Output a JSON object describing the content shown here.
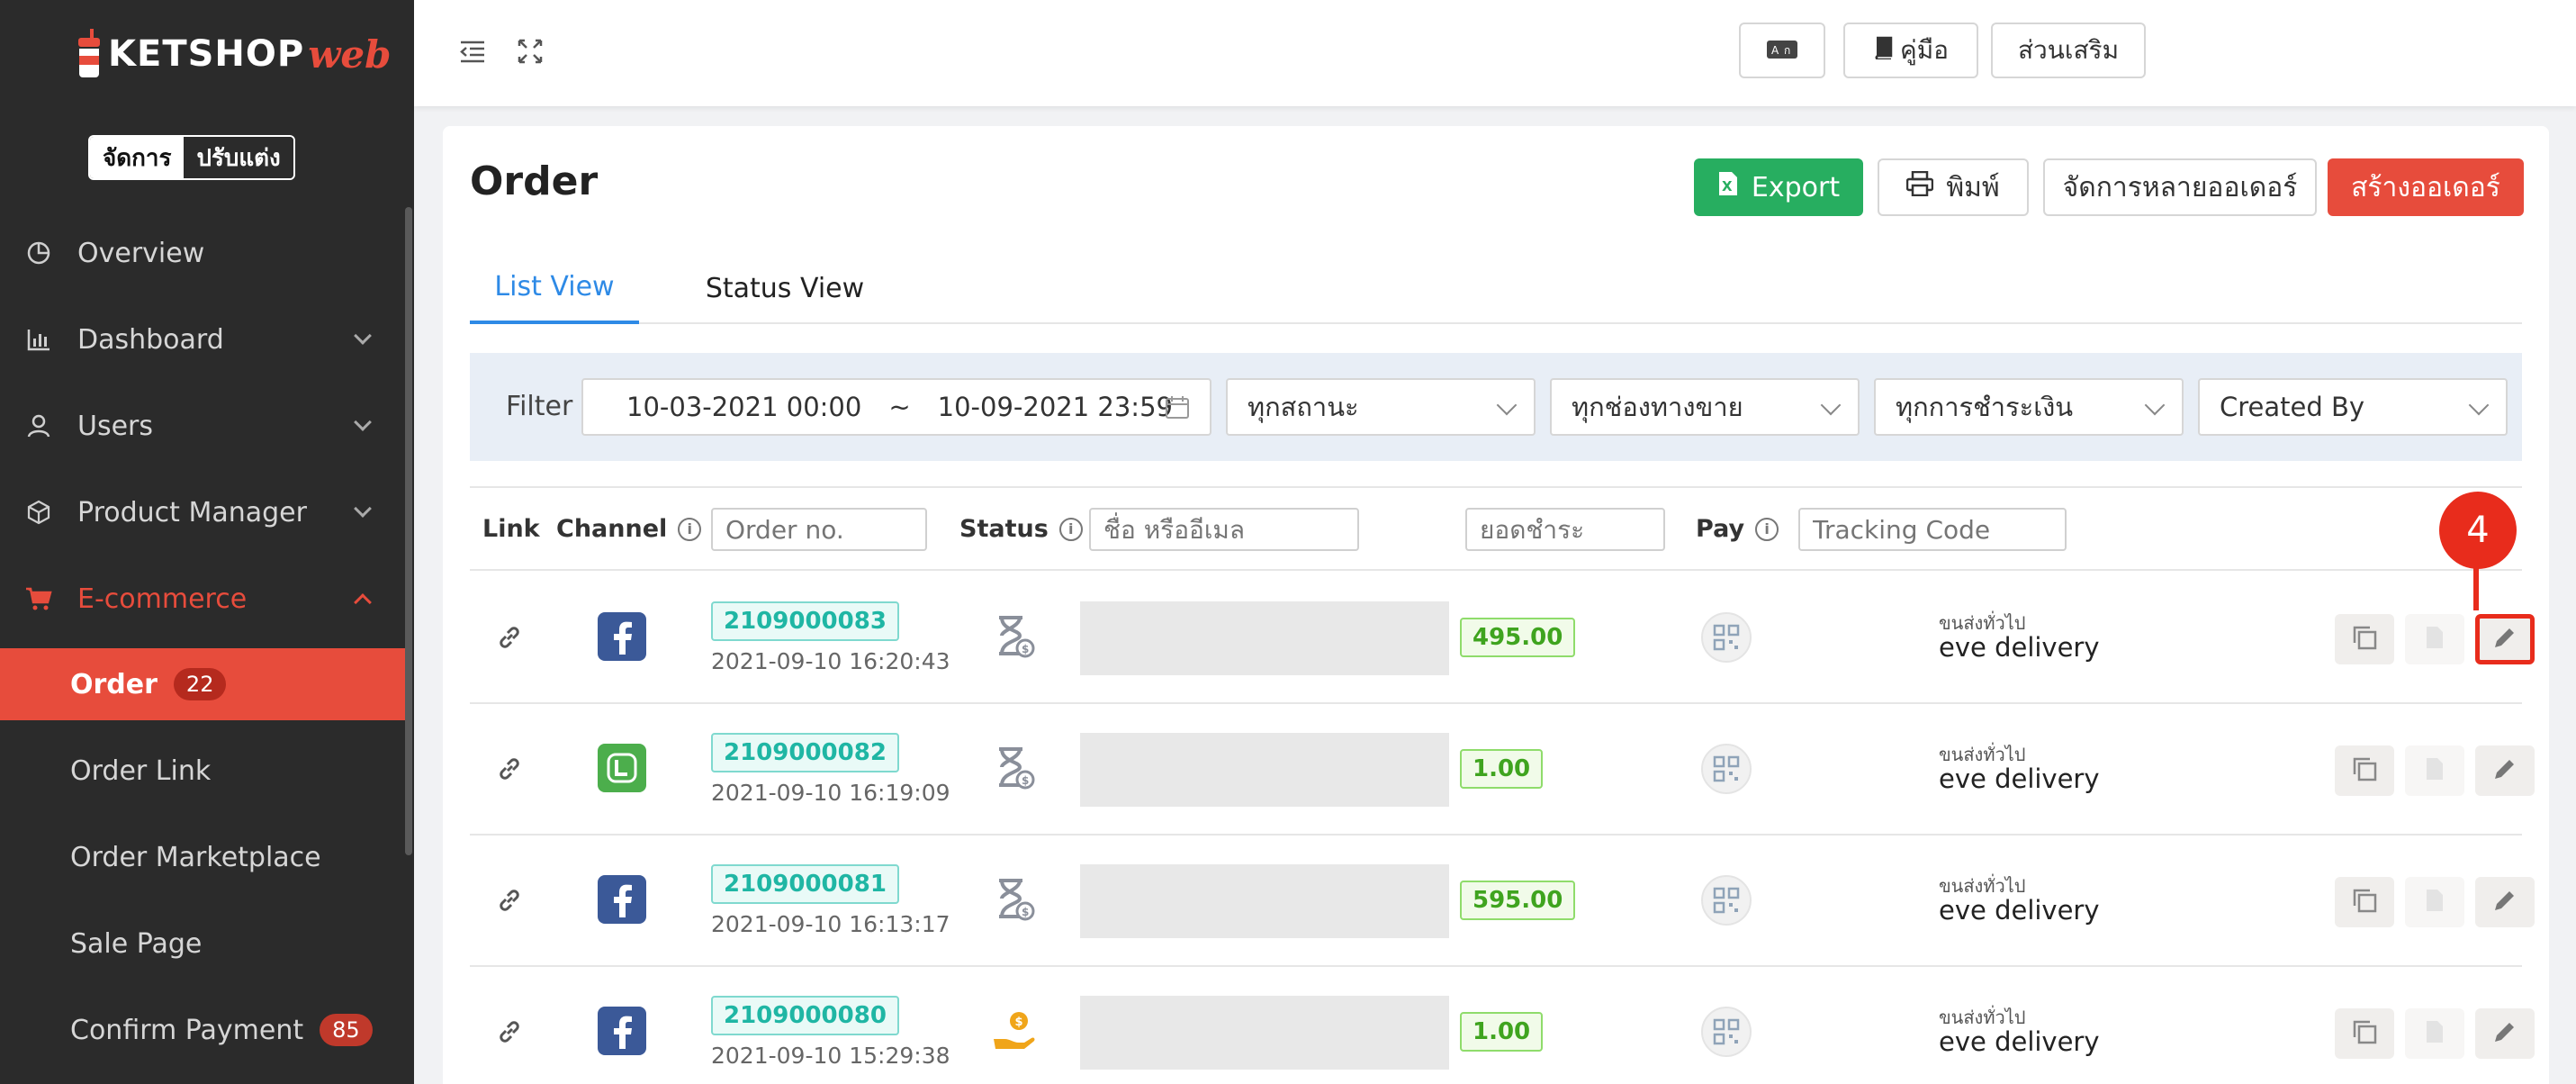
{
  "brand": {
    "name": "KETSHOP",
    "suffix": "web"
  },
  "mode_switch": {
    "manage": "จัดการ",
    "customize": "ปรับแต่ง"
  },
  "sidebar": {
    "items": [
      {
        "label": "Overview",
        "icon": "pie-chart-icon"
      },
      {
        "label": "Dashboard",
        "icon": "bar-chart-icon"
      },
      {
        "label": "Users",
        "icon": "user-icon"
      },
      {
        "label": "Product Manager",
        "icon": "box-icon"
      },
      {
        "label": "E-commerce",
        "icon": "cart-icon"
      }
    ],
    "sub_items": [
      {
        "label": "Order",
        "badge": "22"
      },
      {
        "label": "Order Link"
      },
      {
        "label": "Order Marketplace"
      },
      {
        "label": "Sale Page"
      },
      {
        "label": "Confirm Payment",
        "badge": "85"
      }
    ]
  },
  "topbar": {
    "manual": "คู่มือ",
    "addons": "ส่วนเสริม"
  },
  "page": {
    "title": "Order",
    "export": "Export",
    "print": "พิมพ์",
    "multi": "จัดการหลายออเดอร์",
    "create": "สร้างออเดอร์"
  },
  "tabs": {
    "list": "List View",
    "status": "Status View"
  },
  "filter": {
    "label": "Filter",
    "date_from": "10-03-2021 00:00",
    "sep": "~",
    "date_to": "10-09-2021 23:59",
    "status": "ทุกสถานะ",
    "channel": "ทุกช่องทางขาย",
    "payment": "ทุกการชำระเงิน",
    "created_by": "Created By"
  },
  "table": {
    "headers": {
      "link": "Link",
      "channel": "Channel",
      "status": "Status",
      "pay": "Pay"
    },
    "placeholders": {
      "order_no": "Order no.",
      "name": "ชื่อ หรืออีเมล",
      "amount": "ยอดชำระ",
      "tracking": "Tracking Code"
    },
    "rows": [
      {
        "order_no": "2109000083",
        "date": "2021-09-10 16:20:43",
        "amount": "495.00",
        "ship_type": "ขนส่งทั่วไป",
        "ship_name": "eve delivery",
        "channel": "facebook",
        "status": "pending-payment"
      },
      {
        "order_no": "2109000082",
        "date": "2021-09-10 16:19:09",
        "amount": "1.00",
        "ship_type": "ขนส่งทั่วไป",
        "ship_name": "eve delivery",
        "channel": "line",
        "status": "pending-payment"
      },
      {
        "order_no": "2109000081",
        "date": "2021-09-10 16:13:17",
        "amount": "595.00",
        "ship_type": "ขนส่งทั่วไป",
        "ship_name": "eve delivery",
        "channel": "facebook",
        "status": "pending-payment"
      },
      {
        "order_no": "2109000080",
        "date": "2021-09-10 15:29:38",
        "amount": "1.00",
        "ship_type": "ขนส่งทั่วไป",
        "ship_name": "eve delivery",
        "channel": "facebook",
        "status": "paid"
      }
    ]
  },
  "callout": "4",
  "colors": {
    "accent": "#e74c3c",
    "sidebar": "#2b2b2b",
    "export": "#27ae60",
    "tab_active": "#2e8ae6",
    "highlight": "#e82c1c"
  }
}
